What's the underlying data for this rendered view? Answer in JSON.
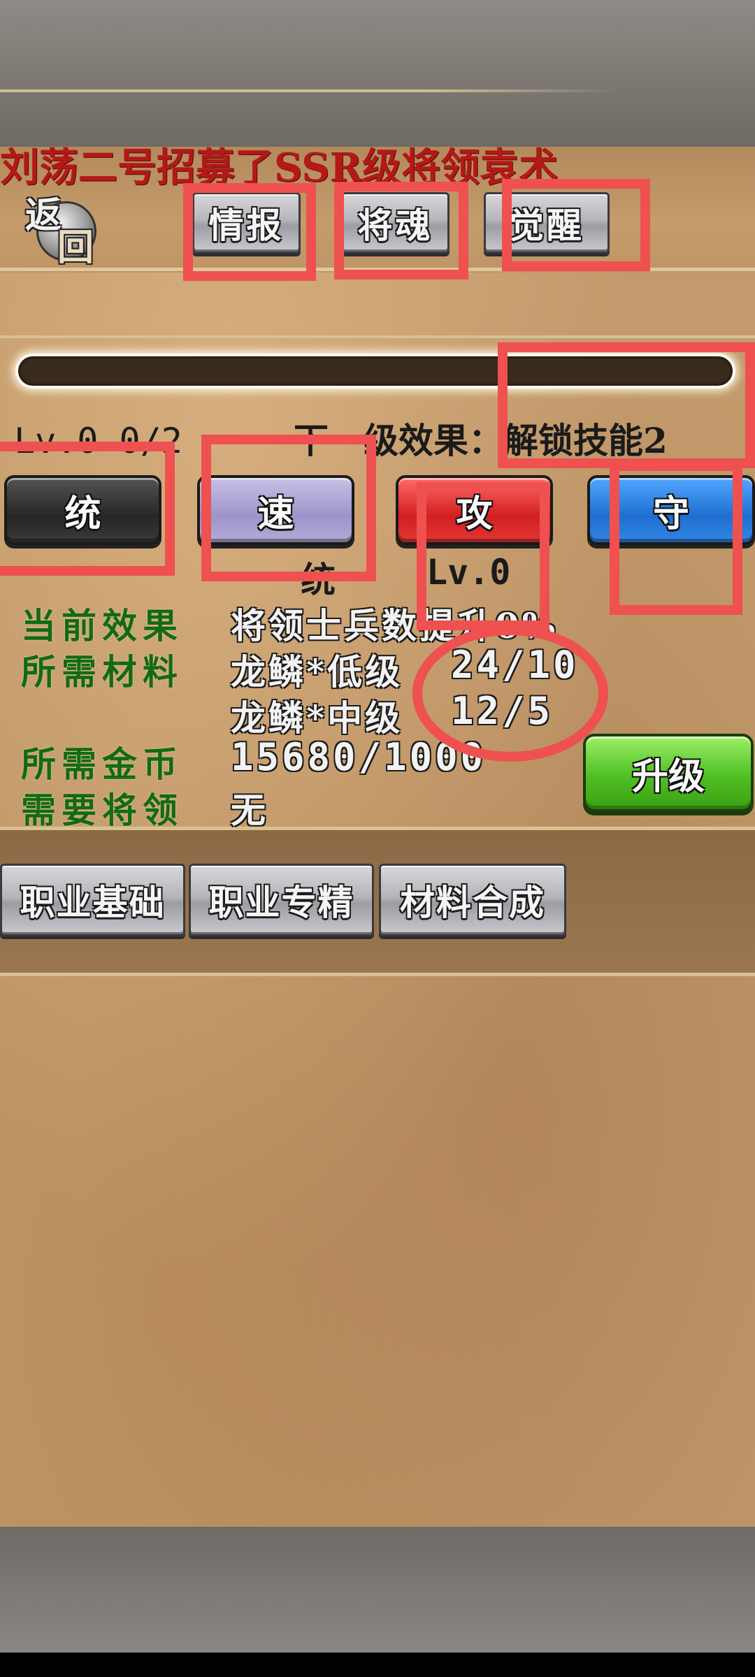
{
  "marquee": {
    "text": "刘荡二号招募了SSR级将领袁术"
  },
  "back_button": {
    "label_top": "返",
    "label_bottom": "回"
  },
  "tabs": [
    {
      "label": "情报"
    },
    {
      "label": "将魂"
    },
    {
      "label": "觉醒"
    }
  ],
  "progress": {
    "value": 0.0
  },
  "level": {
    "text": "Lv.0  0/2",
    "next_effect": "下一级效果：解锁技能2"
  },
  "attributes": [
    {
      "label": "统"
    },
    {
      "label": "速"
    },
    {
      "label": "攻"
    },
    {
      "label": "守"
    }
  ],
  "selected_attribute": {
    "name": "统",
    "level": "Lv.0"
  },
  "info": {
    "current_effect_label": "当前效果",
    "current_effect_value": "将领士兵数提升0%",
    "materials_label": "所需材料",
    "material_1_name": "龙鳞*低级",
    "material_1_count": "24/10",
    "material_2_name": "龙鳞*中级",
    "material_2_count": "12/5",
    "gold_label": "所需金币",
    "gold_value": "15680/1000",
    "general_label": "需要将领",
    "general_value": "无"
  },
  "upgrade_button": {
    "label": "升级"
  },
  "bottom_buttons": [
    {
      "label": "职业基础"
    },
    {
      "label": "职业专精"
    },
    {
      "label": "材料合成"
    }
  ],
  "colors": {
    "annotation": "#ef5050",
    "label_green": "#136a13",
    "marquee_red": "#b41818"
  }
}
